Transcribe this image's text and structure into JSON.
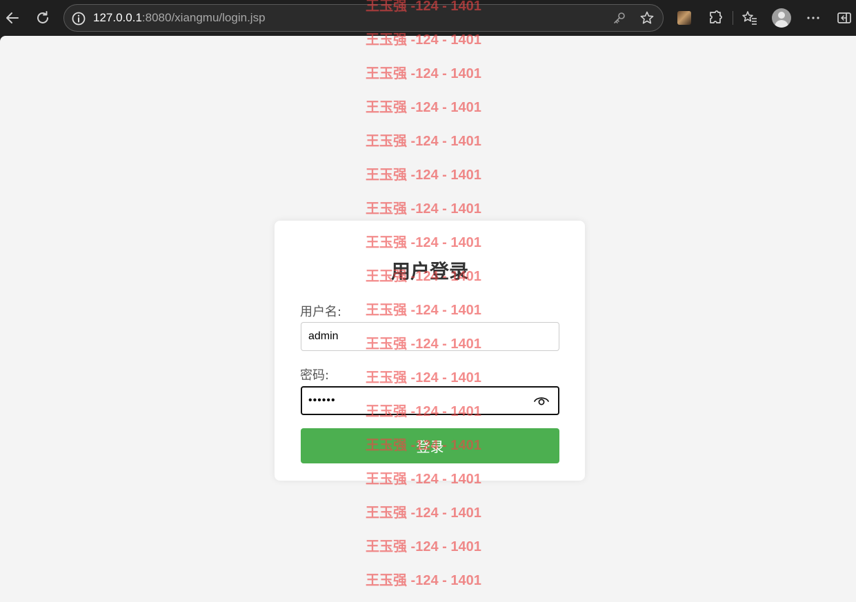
{
  "browser": {
    "url_host": "127.0.0.1",
    "url_rest": ":8080/xiangmu/login.jsp"
  },
  "login_form": {
    "title": "用户登录",
    "username_label": "用户名:",
    "username_value": "admin",
    "password_label": "密码:",
    "password_value": "••••••",
    "submit_label": "登录"
  },
  "watermark": {
    "text": "王玉强 -124 - 1401",
    "count": 18
  },
  "colors": {
    "accent": "#4caf50",
    "watermark": "#eb4646",
    "page_bg": "#f4f4f4",
    "chrome_bg": "#1f1f1f"
  },
  "icons": {
    "toolbar": [
      "back-arrow-icon",
      "refresh-icon",
      "info-icon",
      "key-icon",
      "star-icon",
      "extensions-icon",
      "favorites-icon",
      "profile-icon",
      "more-icon",
      "sidebar-icon"
    ],
    "form": [
      "eye-icon"
    ]
  }
}
